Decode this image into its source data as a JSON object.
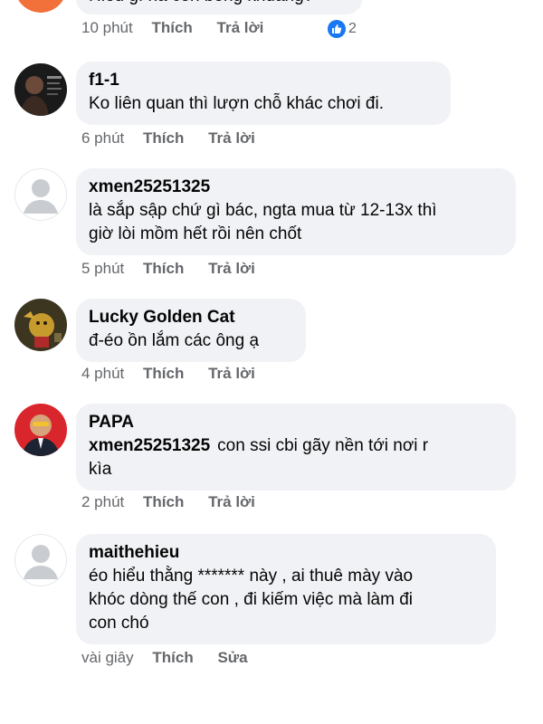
{
  "top_comment": {
    "text": "Hiểu gì ha con bóng khuẩng?",
    "time": "10 phút",
    "like_label": "Thích",
    "reply_label": "Trả lời",
    "reaction_count": "2"
  },
  "comments": [
    {
      "author": "f1-1",
      "text": "Ko liên quan thì lượn chỗ khác chơi đi.",
      "time": "6 phút",
      "like_label": "Thích",
      "reply_label": "Trả lời"
    },
    {
      "author": "xmen25251325",
      "text_line1": "là sắp sập chứ gì bác, ngta mua từ 12-13x thì",
      "text_line2": "giờ lòi mồm hết rồi nên chốt",
      "time": "5 phút",
      "like_label": "Thích",
      "reply_label": "Trả lời"
    },
    {
      "author": "Lucky Golden Cat",
      "text": "đ-éo ồn lắm các ông ạ",
      "time": "4 phút",
      "like_label": "Thích",
      "reply_label": "Trả lời"
    },
    {
      "author": "PAPA",
      "mention": "xmen25251325",
      "text_line1": "con ssi cbi gãy nền tới nơi r",
      "text_line2": "kìa",
      "time": "2 phút",
      "like_label": "Thích",
      "reply_label": "Trả lời"
    },
    {
      "author": "maithehieu",
      "text_line1": "éo hiểu thằng ******* này , ai thuê mày vào",
      "text_line2": "khóc dòng thế con , đi kiếm việc mà làm đi",
      "text_line3": "con chó",
      "time": "vài giây",
      "like_label": "Thích",
      "edit_label": "Sửa"
    }
  ],
  "colors": {
    "bubble": "#f0f2f5",
    "meta": "#65676b",
    "reaction": "#1877f2"
  }
}
